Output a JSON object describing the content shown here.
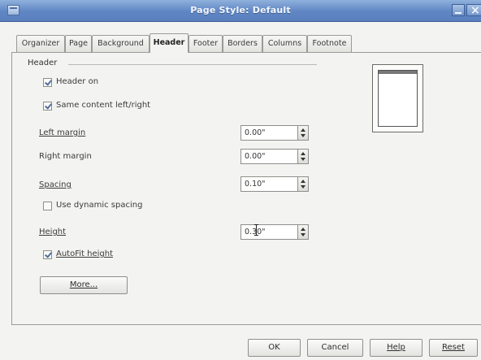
{
  "window": {
    "title": "Page Style: Default"
  },
  "tabs": [
    {
      "label": "Organizer"
    },
    {
      "label": "Page"
    },
    {
      "label": "Background"
    },
    {
      "label": "Header"
    },
    {
      "label": "Footer"
    },
    {
      "label": "Borders"
    },
    {
      "label": "Columns"
    },
    {
      "label": "Footnote"
    }
  ],
  "active_tab": "Header",
  "header_section": {
    "title": "Header",
    "header_on": {
      "label": "Header on",
      "checked": true
    },
    "same_content": {
      "label": "Same content left/right",
      "checked": true
    },
    "left_margin": {
      "label": "Left margin",
      "value": "0.00\""
    },
    "right_margin": {
      "label": "Right margin",
      "value": "0.00\""
    },
    "spacing": {
      "label": "Spacing",
      "value": "0.10\""
    },
    "dynamic_spacing": {
      "label": "Use dynamic spacing",
      "checked": false
    },
    "height": {
      "label": "Height",
      "value": "0.30\""
    },
    "autofit": {
      "label": "AutoFit height",
      "checked": true
    },
    "more_button": "More..."
  },
  "buttons": {
    "ok": "OK",
    "cancel": "Cancel",
    "help": "Help",
    "reset": "Reset"
  }
}
